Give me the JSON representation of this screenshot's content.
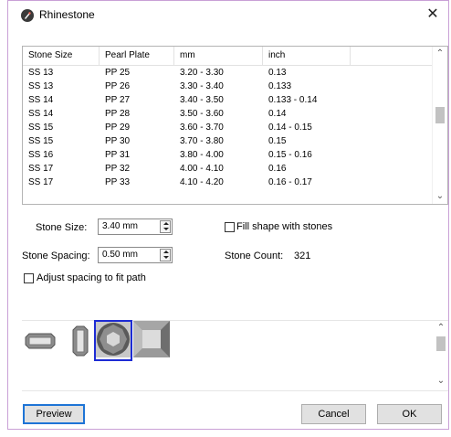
{
  "window": {
    "title": "Rhinestone",
    "close_label": "✕"
  },
  "table": {
    "columns": [
      "Stone Size",
      "Pearl Plate",
      "mm",
      "inch"
    ],
    "rows": [
      [
        "SS 13",
        "PP 25",
        "3.20 - 3.30",
        "0.13"
      ],
      [
        "SS 13",
        "PP 26",
        "3.30 - 3.40",
        "0.133"
      ],
      [
        "SS 14",
        "PP 27",
        "3.40 - 3.50",
        "0.133 - 0.14"
      ],
      [
        "SS 14",
        "PP 28",
        "3.50 - 3.60",
        "0.14"
      ],
      [
        "SS 15",
        "PP 29",
        "3.60 - 3.70",
        "0.14 - 0.15"
      ],
      [
        "SS 15",
        "PP 30",
        "3.70 - 3.80",
        "0.15"
      ],
      [
        "SS 16",
        "PP 31",
        "3.80 - 4.00",
        "0.15 - 0.16"
      ],
      [
        "SS 17",
        "PP 32",
        "4.00 - 4.10",
        "0.16"
      ],
      [
        "SS 17",
        "PP 33",
        "4.10 - 4.20",
        "0.16 - 0.17"
      ]
    ]
  },
  "settings": {
    "stone_size_label": "Stone Size:",
    "stone_size_value": "3.40 mm",
    "stone_spacing_label": "Stone Spacing:",
    "stone_spacing_value": "0.50 mm",
    "fill_shape_label": "Fill shape with stones",
    "fill_shape_checked": false,
    "adjust_spacing_label": "Adjust spacing to fit path",
    "adjust_spacing_checked": false,
    "stone_count_label": "Stone Count:",
    "stone_count_value": "321"
  },
  "shapes": [
    "rect-baguette-horizontal",
    "rect-baguette-vertical",
    "round-stone",
    "square-stone"
  ],
  "selected_shape": "round-stone",
  "buttons": {
    "preview": "Preview",
    "cancel": "Cancel",
    "ok": "OK"
  },
  "colors": {
    "selection": "#1d2bd4",
    "default_button_border": "#1e74d6"
  },
  "icons": {
    "app": "rhinestone-app-icon",
    "close": "close-icon",
    "up": "chevron-up-icon",
    "down": "chevron-down-icon"
  }
}
